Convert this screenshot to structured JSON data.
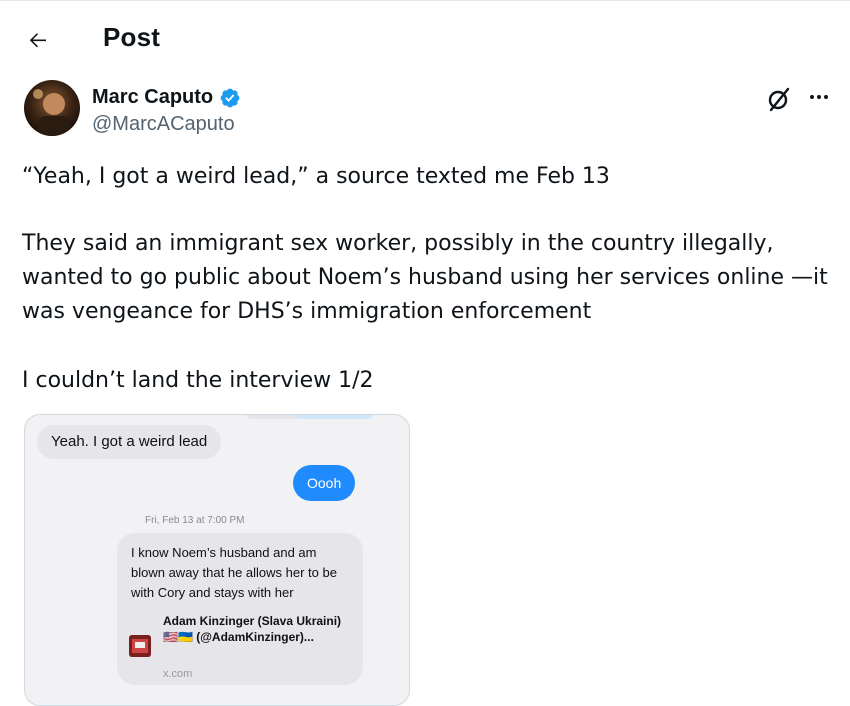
{
  "header": {
    "title": "Post",
    "back_icon": "arrow-left-icon"
  },
  "author": {
    "name": "Marc Caputo",
    "handle": "@MarcACaputo",
    "verified_color": "#1d9bf0"
  },
  "actions": {
    "grok_icon": "grok-icon",
    "more_icon": "more-horizontal-icon"
  },
  "post": {
    "paragraph1": "“Yeah, I got a weird lead,” a source texted me Feb 13",
    "paragraph2": "They said an immigrant sex worker, possibly in the country illegally, wanted to go public about Noem’s husband using her services online —it was vengeance for DHS’s immigration enforcement",
    "paragraph3": "I couldn’t land the interview 1/2"
  },
  "media": {
    "bubble1": "Yeah. I got a weird lead",
    "bubble2": "Oooh",
    "timestamp": "Fri, Feb 13 at 7:00 PM",
    "bubble3": "I know Noem’s husband and am blown away that he allows her to be with Cory and stays with her",
    "link_title": "Adam Kinzinger (Slava Ukraini) 🇺🇸🇺🇦 (@AdamKinzinger)...",
    "link_domain": "x.com"
  },
  "colors": {
    "text": "#0f1419",
    "secondary": "#536471",
    "imessage_blue": "#1f8bff",
    "imessage_gray": "#e5e5ea"
  }
}
